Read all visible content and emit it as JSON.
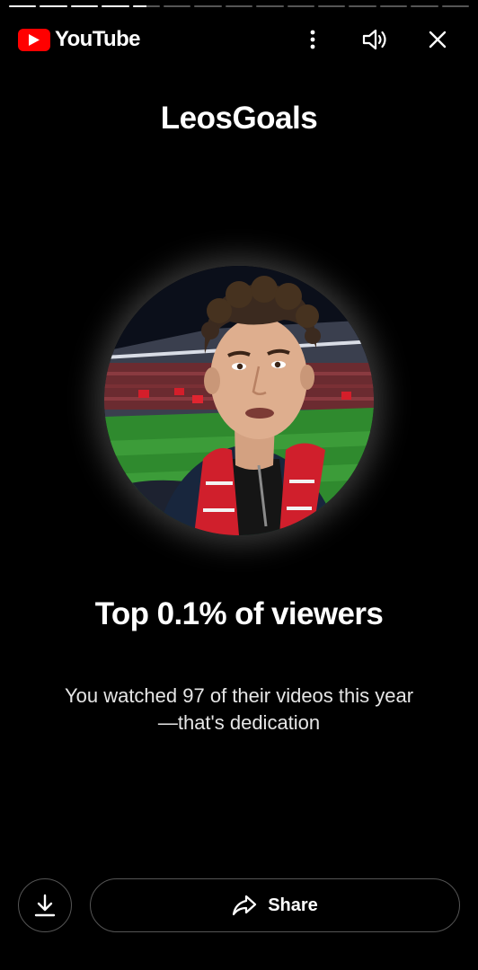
{
  "progress": {
    "total_segments": 15,
    "completed_segments": 4,
    "current_segment_fraction": 0.5
  },
  "header": {
    "brand": "YouTube",
    "icons": {
      "logo": "youtube-play-icon",
      "more": "more-vert-icon",
      "volume": "volume-icon",
      "close": "close-icon"
    }
  },
  "card": {
    "channel_name": "LeosGoals",
    "avatar": "channel-avatar",
    "headline": "Top 0.1% of viewers",
    "subtext_line1": "You watched 97 of their videos this year",
    "subtext_line2": "—that's dedication"
  },
  "footer": {
    "share_label": "Share",
    "icons": {
      "download": "download-icon",
      "share": "share-arrow-icon"
    }
  },
  "colors": {
    "background": "#000000",
    "brand_red": "#ff0000",
    "text": "#ffffff"
  }
}
